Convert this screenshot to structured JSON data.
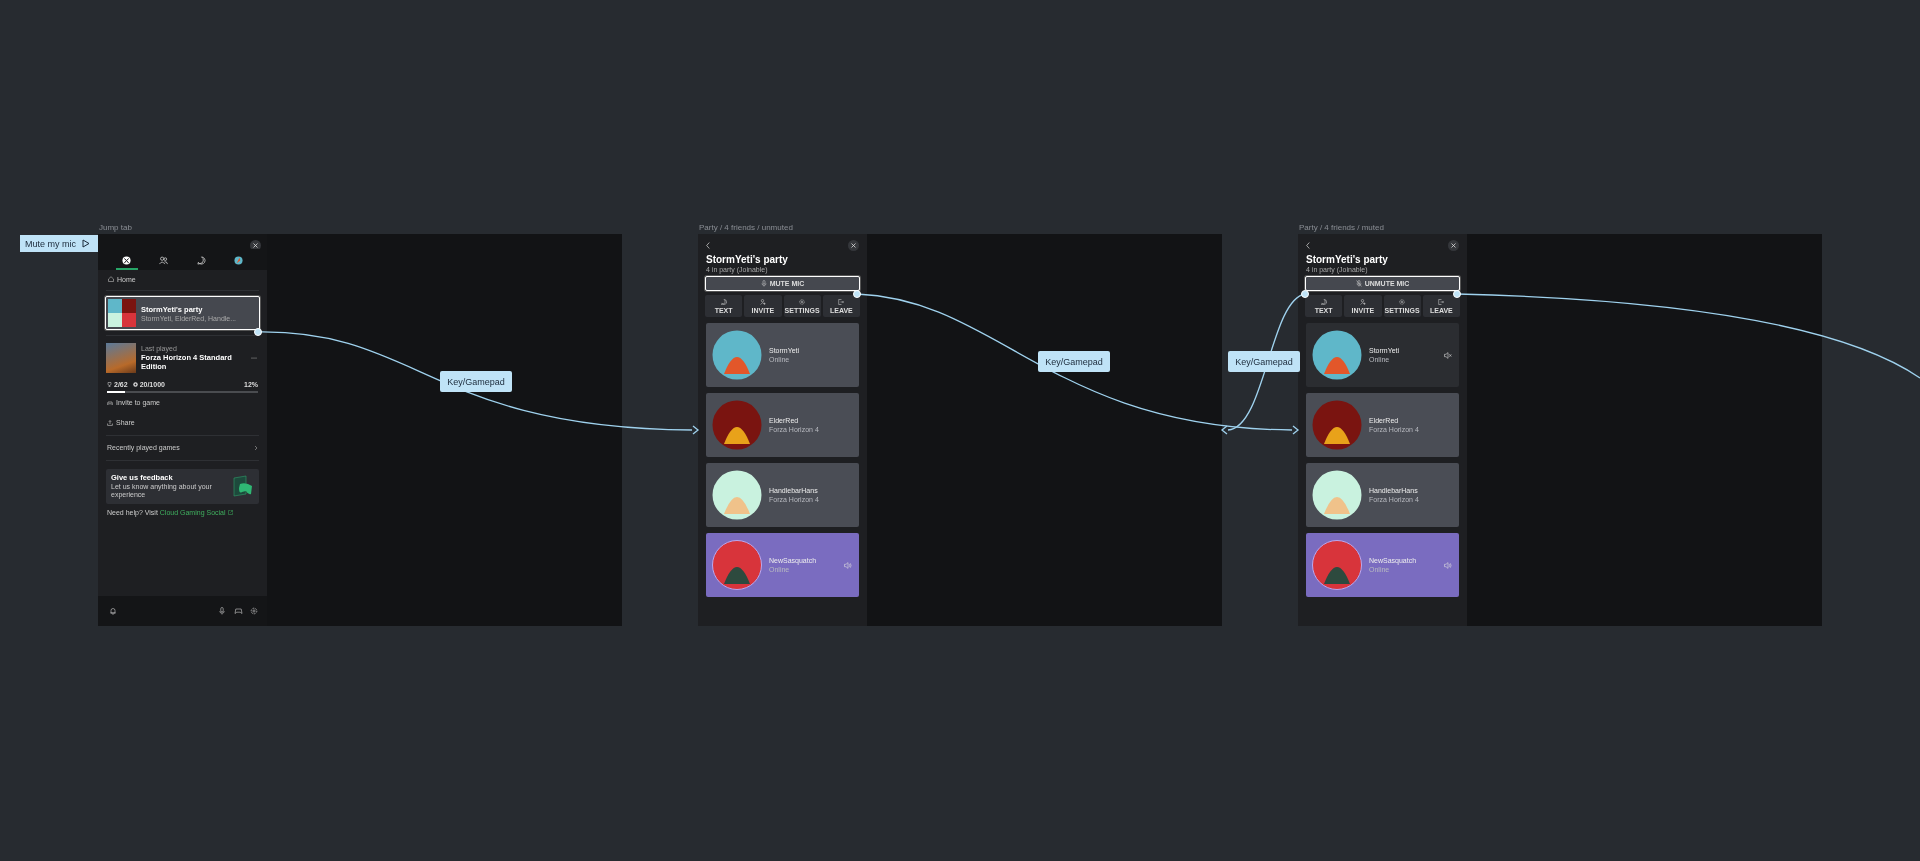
{
  "hotspot_tag": {
    "label": "Mute my mic"
  },
  "frames": [
    {
      "kind": "jump_tab",
      "title": "Jump tab",
      "tabs": [
        {
          "kind": "xbox",
          "selected": true
        },
        {
          "kind": "friends",
          "selected": false
        },
        {
          "kind": "chat",
          "selected": false
        },
        {
          "kind": "profile",
          "selected": false
        }
      ],
      "home": "Home",
      "party_card": {
        "title": "StormYeti's party",
        "subtitle": "StormYeti, ElderRed, Handle...",
        "focused": true
      },
      "game": {
        "caption": "Last played",
        "title": "Forza Horizon 4 Standard Edition",
        "achievements": "2/62",
        "gamerscore": "20/1000",
        "percent": "12%",
        "level": 0.12
      },
      "actions": [
        {
          "kind": "invite",
          "label": "Invite to game"
        },
        {
          "kind": "share",
          "label": "Share"
        }
      ],
      "recent": "Recently played games",
      "feedback": {
        "title": "Give us feedback",
        "text": "Let us know anything about your experience"
      },
      "help": {
        "text": "Need help? Visit",
        "link": "Cloud Gaming Social"
      }
    },
    {
      "kind": "party",
      "title": "Party / 4 friends / unmuted",
      "party_title": "StormYeti's party",
      "subtitle": "4 in party (Joinable)",
      "mic_button": {
        "label": "MUTE MIC",
        "muted": false,
        "focused": true
      },
      "actions": [
        {
          "kind": "text",
          "label": "TEXT"
        },
        {
          "kind": "invite",
          "label": "INVITE"
        },
        {
          "kind": "settings",
          "label": "SETTINGS"
        },
        {
          "kind": "leave",
          "label": "LEAVE"
        }
      ],
      "members": [
        {
          "name": "StormYeti",
          "status": "Online",
          "muted": false,
          "speaking": false
        },
        {
          "name": "ElderRed",
          "status": "Forza Horizon 4",
          "muted": false,
          "speaking": false
        },
        {
          "name": "HandlebarHans",
          "status": "Forza Horizon 4",
          "muted": false,
          "speaking": false
        },
        {
          "name": "NewSasquatch",
          "status": "Online",
          "muted": false,
          "speaking": true
        }
      ]
    },
    {
      "kind": "party",
      "title": "Party / 4 friends / muted",
      "party_title": "StormYeti's party",
      "subtitle": "4 in party (Joinable)",
      "mic_button": {
        "label": "UNMUTE MIC",
        "muted": true,
        "focused": true
      },
      "actions": [
        {
          "kind": "text",
          "label": "TEXT"
        },
        {
          "kind": "invite",
          "label": "INVITE"
        },
        {
          "kind": "settings",
          "label": "SETTINGS"
        },
        {
          "kind": "leave",
          "label": "LEAVE"
        }
      ],
      "members": [
        {
          "name": "StormYeti",
          "status": "Online",
          "muted": true,
          "speaking": false
        },
        {
          "name": "ElderRed",
          "status": "Forza Horizon 4",
          "muted": false,
          "speaking": false
        },
        {
          "name": "HandlebarHans",
          "status": "Forza Horizon 4",
          "muted": false,
          "speaking": false
        },
        {
          "name": "NewSasquatch",
          "status": "Online",
          "muted": false,
          "speaking": true
        }
      ]
    }
  ],
  "connectors": [
    {
      "label": "Key/Gamepad"
    },
    {
      "label": "Key/Gamepad"
    },
    {
      "label": "Key/Gamepad"
    }
  ]
}
